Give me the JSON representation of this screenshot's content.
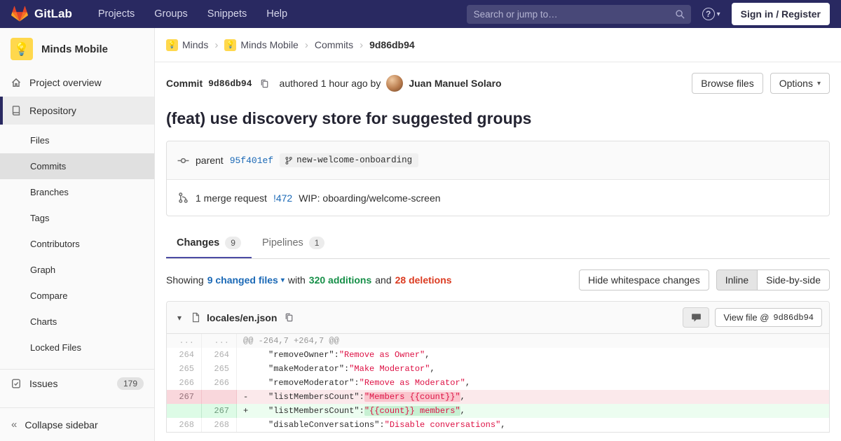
{
  "colors": {
    "navbar_bg": "#292961",
    "accent_indigo": "#4b4ba3",
    "link_blue": "#1b69b6",
    "addition_green": "#168f48",
    "deletion_red": "#db3b21",
    "brand_orange": "#e24329"
  },
  "icons": {
    "caret_down": "▾",
    "chevron_right": "›",
    "collapse_chevrons": "«",
    "help": "?",
    "project_logo": "💡"
  },
  "navbar": {
    "brand": "GitLab",
    "menu": [
      "Projects",
      "Groups",
      "Snippets",
      "Help"
    ],
    "search_placeholder": "Search or jump to…",
    "sign_in": "Sign in / Register"
  },
  "sidebar": {
    "project_name": "Minds Mobile",
    "overview_label": "Project overview",
    "repository_label": "Repository",
    "repo_subitems": [
      "Files",
      "Commits",
      "Branches",
      "Tags",
      "Contributors",
      "Graph",
      "Compare",
      "Charts",
      "Locked Files"
    ],
    "issues_label": "Issues",
    "issues_count": "179",
    "collapse_label": "Collapse sidebar"
  },
  "breadcrumb": {
    "items": [
      "Minds",
      "Minds Mobile",
      "Commits"
    ],
    "current": "9d86db94"
  },
  "commit": {
    "label": "Commit",
    "sha": "9d86db94",
    "authored": "authored 1 hour ago by",
    "author": "Juan Manuel Solaro",
    "browse_files": "Browse files",
    "options": "Options",
    "title": "(feat) use discovery store for suggested groups",
    "parent_label": "parent",
    "parent_sha": "95f401ef",
    "branch": "new-welcome-onboarding",
    "mr_text": "1 merge request",
    "mr_ref": "!472",
    "mr_title": "WIP: oboarding/welcome-screen"
  },
  "tabs": [
    {
      "label": "Changes",
      "count": "9"
    },
    {
      "label": "Pipelines",
      "count": "1"
    }
  ],
  "summary": {
    "showing": "Showing",
    "files": "9 changed files",
    "with": "with",
    "additions": "320 additions",
    "and": "and",
    "deletions": "28 deletions",
    "hide_whitespace": "Hide whitespace changes",
    "inline": "Inline",
    "side_by_side": "Side-by-side"
  },
  "diff": {
    "file_name": "locales/en.json",
    "view_file_prefix": "View file @",
    "view_file_sha": "9d86db94",
    "hunk_old": "...",
    "hunk_new": "...",
    "hunk_text": "@@ -264,7 +264,7 @@",
    "lines": [
      {
        "old": "264",
        "new": "264",
        "sign": " ",
        "type": "context",
        "key": "    \"removeOwner\":",
        "value": "\"Remove as Owner\"",
        "comma": ","
      },
      {
        "old": "265",
        "new": "265",
        "sign": " ",
        "type": "context",
        "key": "    \"makeModerator\":",
        "value": "\"Make Moderator\"",
        "comma": ","
      },
      {
        "old": "266",
        "new": "266",
        "sign": " ",
        "type": "context",
        "key": "    \"removeModerator\":",
        "value": "\"Remove as Moderator\"",
        "comma": ","
      },
      {
        "old": "267",
        "new": "",
        "sign": "-",
        "type": "del",
        "key": "    \"listMembersCount\":",
        "value": "\"Members {{count}}\"",
        "comma": ","
      },
      {
        "old": "",
        "new": "267",
        "sign": "+",
        "type": "add",
        "key": "    \"listMembersCount\":",
        "value": "\"{{count}} members\"",
        "comma": ","
      },
      {
        "old": "268",
        "new": "268",
        "sign": " ",
        "type": "context",
        "key": "    \"disableConversations\":",
        "value": "\"Disable conversations\"",
        "comma": ","
      }
    ]
  }
}
